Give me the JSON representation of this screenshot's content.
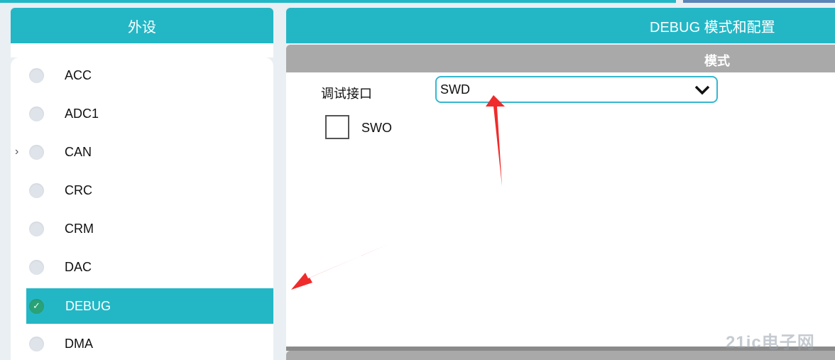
{
  "left_panel": {
    "title": "外设",
    "items": [
      {
        "label": "ACC",
        "selected": false
      },
      {
        "label": "ADC1",
        "selected": false
      },
      {
        "label": "CAN",
        "selected": false,
        "expandable": true
      },
      {
        "label": "CRC",
        "selected": false
      },
      {
        "label": "CRM",
        "selected": false
      },
      {
        "label": "DAC",
        "selected": false
      },
      {
        "label": "DEBUG",
        "selected": true,
        "check_mark": "✓"
      },
      {
        "label": "DMA",
        "selected": false
      }
    ]
  },
  "right_panel": {
    "title": "DEBUG 模式和配置",
    "section_mode": "模式",
    "debug_interface_label": "调试接口",
    "debug_interface_value": "SWD",
    "swo_label": "SWO",
    "swo_checked": false
  },
  "watermark": "21ic电子网",
  "colors": {
    "accent": "#23b7c6",
    "section_bar": "#a9a9a9",
    "annotation_arrow": "#f02b2b",
    "selected_check": "#2aa277"
  }
}
